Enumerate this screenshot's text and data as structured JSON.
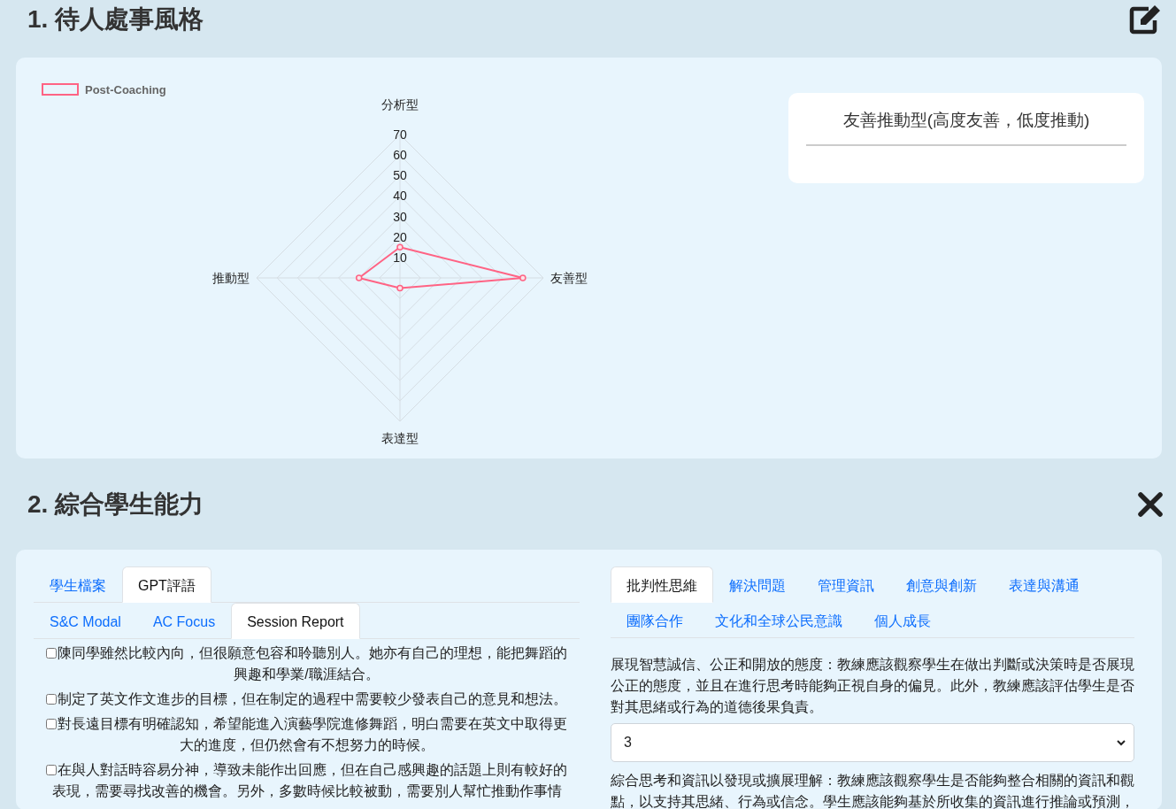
{
  "style_section": {
    "title": "1. 待人處事風格",
    "chart": {
      "chart_data": {
        "type": "radar",
        "categories": [
          "分析型",
          "友善型",
          "表達型",
          "推動型"
        ],
        "series": [
          {
            "name": "Post-Coaching",
            "color": "#ff6384",
            "values": [
              15,
              60,
              5,
              20
            ]
          }
        ],
        "ylim": [
          0,
          70
        ],
        "yticks": [
          10,
          20,
          30,
          40,
          50,
          60,
          70
        ]
      }
    },
    "result": "友善推動型(高度友善，低度推動)"
  },
  "ability_section": {
    "title": "2. 綜合學生能力",
    "left": {
      "tabs": [
        {
          "label": "學生檔案",
          "selected": false
        },
        {
          "label": "GPT評語",
          "selected": true
        }
      ],
      "subtabs": [
        {
          "label": "S&C Modal",
          "selected": false
        },
        {
          "label": "AC Focus",
          "selected": false
        },
        {
          "label": "Session Report",
          "selected": true
        }
      ],
      "items": [
        {
          "text": "陳同學雖然比較內向，但很願意包容和聆聽別人。她亦有自己的理想，能把舞蹈的興趣和學業/職涯結合。",
          "checked": false
        },
        {
          "text": "制定了英文作文進步的目標，但在制定的過程中需要較少發表自己的意見和想法。",
          "checked": false
        },
        {
          "text": "對長遠目標有明確認知，希望能進入演藝學院進修舞蹈，明白需要在英文中取得更大的進度，但仍然會有不想努力的時候。",
          "checked": false
        },
        {
          "text": "在與人對話時容易分神，導致未能作出回應，但在自己感興趣的話題上則有較好的表現，需要尋找改善的機會。另外，多數時候比較被動，需要別人幫忙推動作事情",
          "checked": false
        }
      ]
    },
    "right": {
      "tabs": [
        {
          "label": "批判性思維",
          "selected": true
        },
        {
          "label": "解決問題",
          "selected": false
        },
        {
          "label": "管理資訊",
          "selected": false
        },
        {
          "label": "創意與創新",
          "selected": false
        },
        {
          "label": "表達與溝通",
          "selected": false
        },
        {
          "label": "團隊合作",
          "selected": false
        },
        {
          "label": "文化和全球公民意識",
          "selected": false
        },
        {
          "label": "個人成長",
          "selected": false
        }
      ],
      "criteria": [
        {
          "description": "展現智慧誠信、公正和開放的態度：教練應該觀察學生在做出判斷或決策時是否展現公正的態度，並且在進行思考時能夠正視自身的偏見。此外，教練應該評估學生是否對其思緒或行為的道德後果負責。",
          "score": "3"
        },
        {
          "description": "綜合思考和資訊以發現或擴展理解：教練應該觀察學生是否能夠整合相關的資訊和觀點，以支持其思緒、行為或信念。學生應該能夠基於所收集的資訊進行推論或預測，"
        }
      ]
    }
  }
}
